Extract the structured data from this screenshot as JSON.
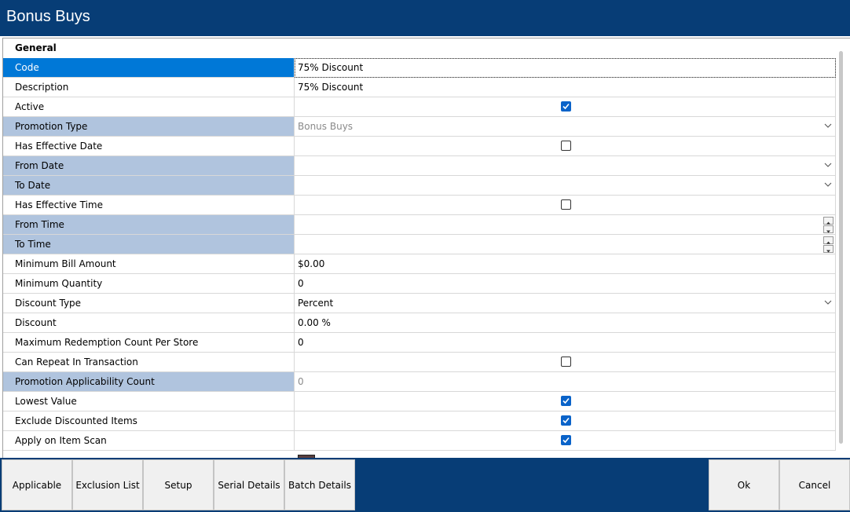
{
  "window": {
    "title": "Bonus Buys"
  },
  "section": {
    "title": "General"
  },
  "rows": [
    {
      "label": "Code",
      "value": "75% Discount"
    },
    {
      "label": "Description",
      "value": "75% Discount"
    },
    {
      "label": "Active",
      "checked": true
    },
    {
      "label": "Promotion Type",
      "value": "Bonus Buys"
    },
    {
      "label": "Has Effective Date",
      "checked": false
    },
    {
      "label": "From Date",
      "value": ""
    },
    {
      "label": "To Date",
      "value": ""
    },
    {
      "label": "Has Effective Time",
      "checked": false
    },
    {
      "label": "From Time",
      "value": ""
    },
    {
      "label": "To Time",
      "value": ""
    },
    {
      "label": "Minimum Bill Amount",
      "value": "$0.00"
    },
    {
      "label": "Minimum Quantity",
      "value": "0"
    },
    {
      "label": "Discount Type",
      "value": "Percent"
    },
    {
      "label": "Discount",
      "value": "0.00 %"
    },
    {
      "label": "Maximum Redemption Count Per Store",
      "value": "0"
    },
    {
      "label": "Can Repeat In Transaction",
      "checked": false
    },
    {
      "label": "Promotion Applicability Count",
      "value": "0"
    },
    {
      "label": "Lowest Value",
      "checked": true
    },
    {
      "label": "Exclude Discounted Items",
      "checked": true
    },
    {
      "label": "Apply on Item Scan",
      "checked": true
    }
  ],
  "buttons": {
    "applicable": "Applicable",
    "exclusion_list": "Exclusion List",
    "setup": "Setup",
    "serial_details": "Serial Details",
    "batch_details": "Batch Details",
    "ok": "Ok",
    "cancel": "Cancel"
  },
  "colors": {
    "titlebar": "#073d76",
    "selected_row": "#0078d7",
    "readonly_label": "#b0c4de",
    "checkbox_checked": "#0a63c9"
  },
  "icons": {
    "dropdown": "chevron-down-icon",
    "spinner": "spin-up-down-icon",
    "checkbox": "checkmark-icon"
  }
}
